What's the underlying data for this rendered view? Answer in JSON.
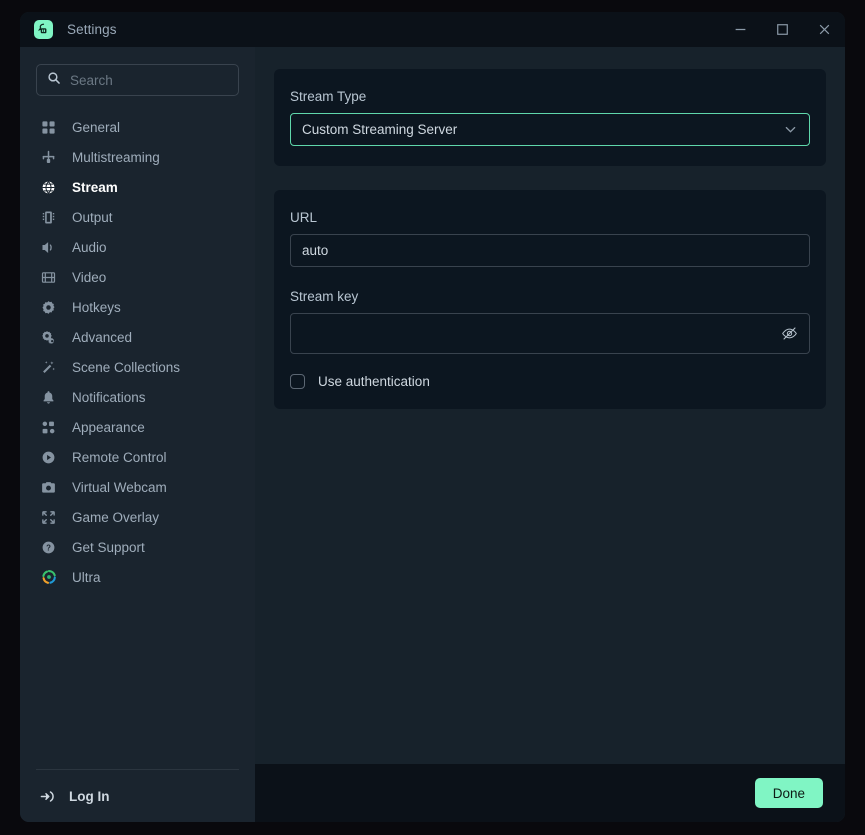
{
  "window": {
    "title": "Settings",
    "app_icon": "streamlabs-logo-icon",
    "controls": {
      "minimize": "minimize-icon",
      "maximize": "maximize-icon",
      "close": "close-icon"
    }
  },
  "sidebar": {
    "search": {
      "value": "",
      "placeholder": "Search",
      "icon": "search-icon"
    },
    "items": [
      {
        "label": "General",
        "icon": "grid-icon",
        "active": false
      },
      {
        "label": "Multistreaming",
        "icon": "multistream-icon",
        "active": false
      },
      {
        "label": "Stream",
        "icon": "globe-icon",
        "active": true
      },
      {
        "label": "Output",
        "icon": "chip-icon",
        "active": false
      },
      {
        "label": "Audio",
        "icon": "speaker-icon",
        "active": false
      },
      {
        "label": "Video",
        "icon": "film-icon",
        "active": false
      },
      {
        "label": "Hotkeys",
        "icon": "gear-icon",
        "active": false
      },
      {
        "label": "Advanced",
        "icon": "gears-icon",
        "active": false
      },
      {
        "label": "Scene Collections",
        "icon": "wand-icon",
        "active": false
      },
      {
        "label": "Notifications",
        "icon": "bell-icon",
        "active": false
      },
      {
        "label": "Appearance",
        "icon": "appearance-icon",
        "active": false
      },
      {
        "label": "Remote Control",
        "icon": "play-circle-icon",
        "active": false
      },
      {
        "label": "Virtual Webcam",
        "icon": "camera-icon",
        "active": false
      },
      {
        "label": "Game Overlay",
        "icon": "expand-icon",
        "active": false
      },
      {
        "label": "Get Support",
        "icon": "help-circle-icon",
        "active": false
      },
      {
        "label": "Ultra",
        "icon": "ultra-icon",
        "active": false
      }
    ],
    "login": {
      "label": "Log In",
      "icon": "login-icon"
    }
  },
  "main": {
    "stream_type": {
      "label": "Stream Type",
      "value": "Custom Streaming Server",
      "chevron_icon": "chevron-down-icon"
    },
    "url": {
      "label": "URL",
      "value": "auto",
      "placeholder": ""
    },
    "stream_key": {
      "label": "Stream key",
      "value": "",
      "placeholder": "",
      "reveal_icon": "eye-slash-icon"
    },
    "use_authentication": {
      "label": "Use authentication",
      "checked": false
    }
  },
  "footer": {
    "done_label": "Done"
  },
  "colors": {
    "accent": "#80f5c4",
    "focus_border": "#5fd7ab",
    "window_bg": "#17222b",
    "sidebar_bg": "#1a242e",
    "card_bg": "#0c1620",
    "titlebar_bg": "#0b1118"
  }
}
